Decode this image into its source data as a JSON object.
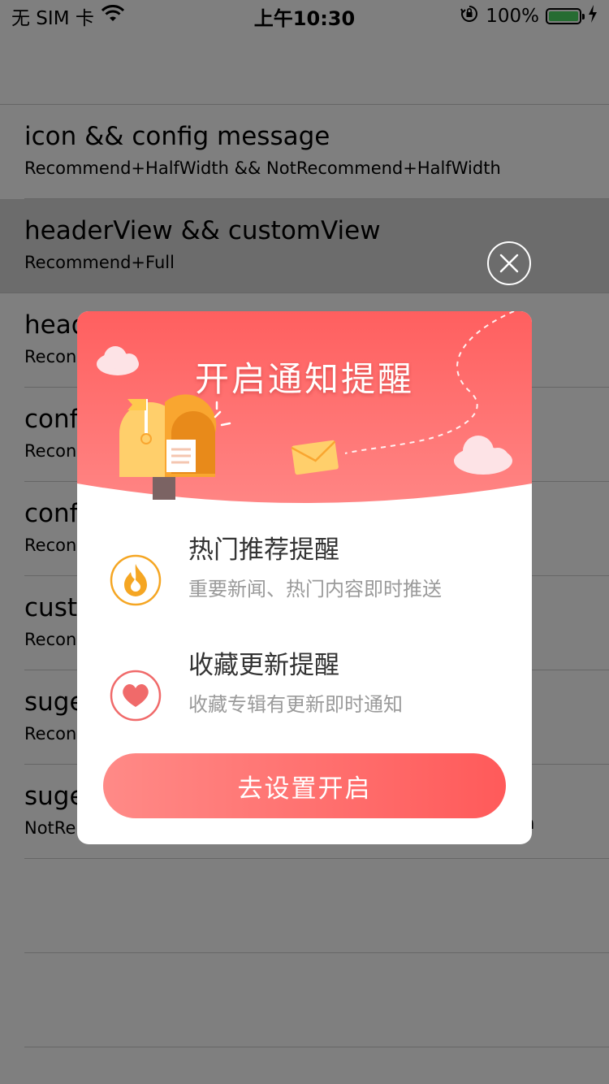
{
  "status_bar": {
    "carrier": "无 SIM 卡",
    "time": "上午10:30",
    "battery": "100%",
    "battery_level": 1.0
  },
  "list": {
    "rows": [
      {
        "title": "icon && config message",
        "subtitle": "Recommend+HalfWidth && NotRecommend+HalfWidth"
      },
      {
        "title": "headerView && customView",
        "subtitle": "Recommend+Full"
      },
      {
        "title": "head",
        "subtitle": "Recon"
      },
      {
        "title": "conf",
        "subtitle": "Recon"
      },
      {
        "title": "conf",
        "subtitle": "Recon"
      },
      {
        "title": "cust",
        "subtitle": "Recon"
      },
      {
        "title": "suge",
        "subtitle": "Recon"
      },
      {
        "title": "suge",
        "subtitle": "NotRe",
        "trailing": "n"
      }
    ]
  },
  "popup": {
    "title": "开启通知提醒",
    "options": [
      {
        "icon": "fire-icon",
        "title": "热门推荐提醒",
        "desc": "重要新闻、热门内容即时推送"
      },
      {
        "icon": "heart-icon",
        "title": "收藏更新提醒",
        "desc": "收藏专辑有更新即时通知"
      }
    ],
    "button_label": "去设置开启"
  },
  "colors": {
    "accent": "#ff5a5a",
    "accent_light": "#ff8a87",
    "fire": "#f5a623",
    "heart": "#f06a6a"
  }
}
